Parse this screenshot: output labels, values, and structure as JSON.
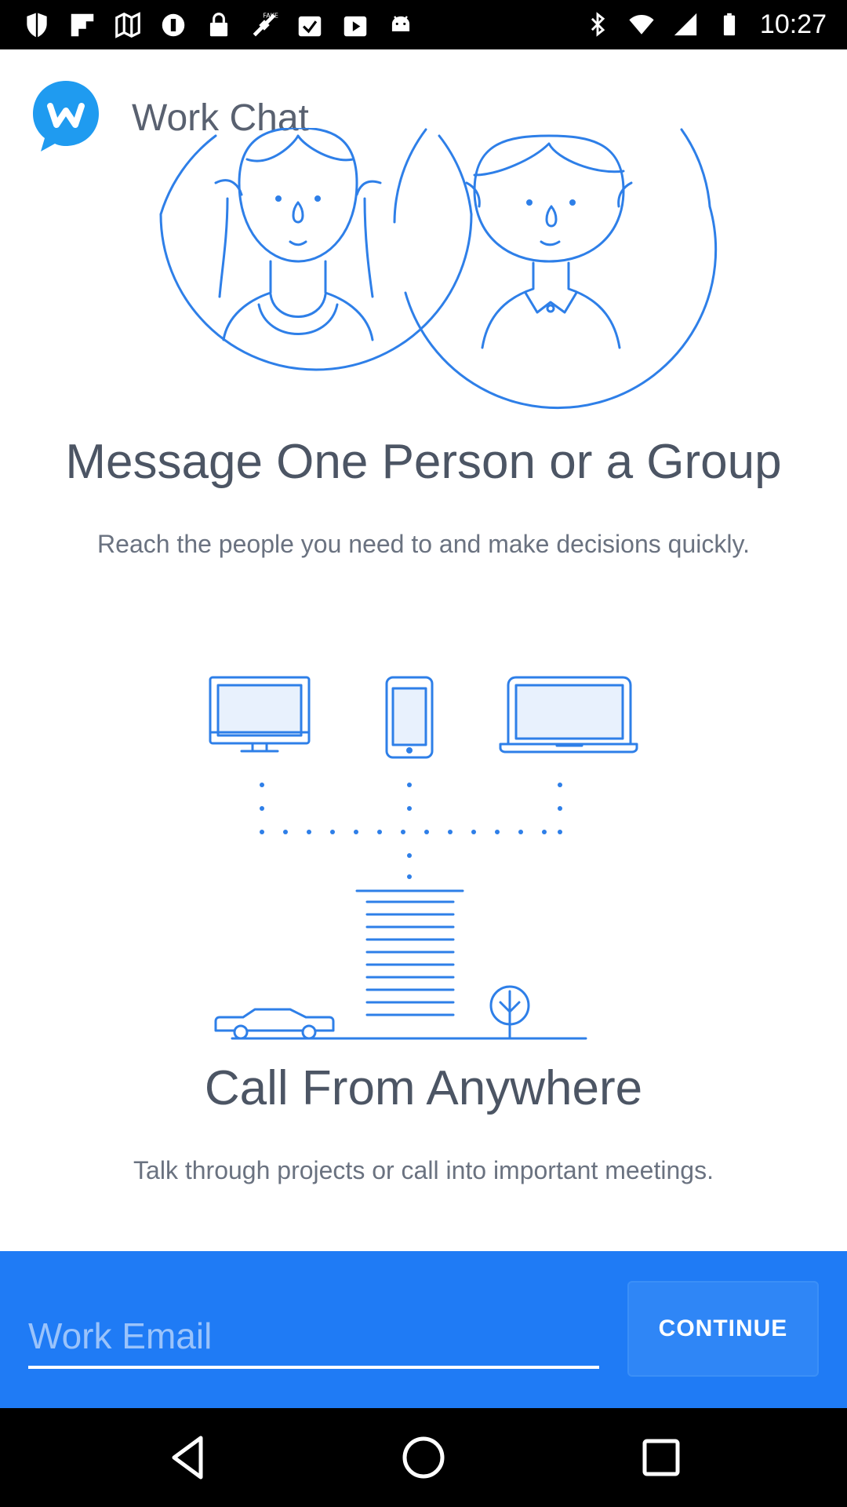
{
  "status_bar": {
    "time": "10:27",
    "left_icons": [
      "shield-icon",
      "flipboard-icon",
      "maps-icon",
      "circle-icon",
      "lock-icon",
      "fake-gps-icon",
      "check-icon",
      "play-icon",
      "android-icon"
    ],
    "right_icons": [
      "bluetooth-icon",
      "wifi-icon",
      "signal-icon",
      "battery-icon"
    ]
  },
  "header": {
    "app_title": "Work Chat",
    "logo_letter": "W"
  },
  "section1": {
    "title": "Message One Person or a Group",
    "subtitle": "Reach the people you need to and make decisions quickly."
  },
  "section2": {
    "title": "Call From Anywhere",
    "subtitle": "Talk through projects or call into important meetings."
  },
  "signin": {
    "email_placeholder": "Work Email",
    "email_value": "",
    "continue_label": "CONTINUE"
  },
  "colors": {
    "brand_blue": "#1f7bf5",
    "illustration_blue": "#2e7fe8",
    "text_dark": "#4c5564",
    "text_muted": "#6a7280"
  }
}
